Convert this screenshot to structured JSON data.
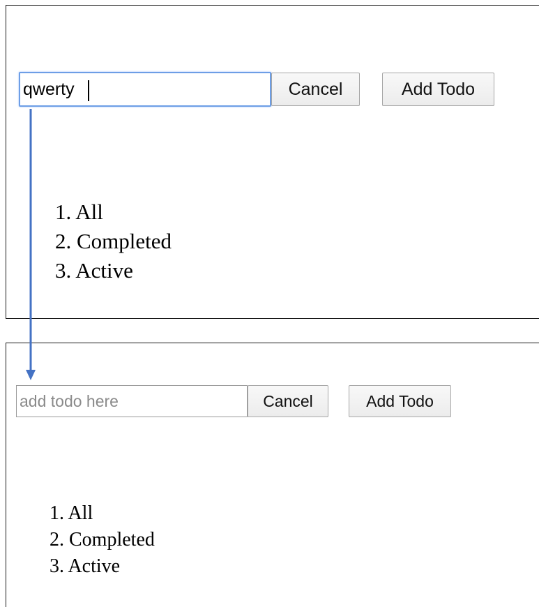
{
  "states": [
    {
      "input_value": "qwerty",
      "input_placeholder": "add todo here",
      "cancel_label": "Cancel",
      "add_label": "Add Todo",
      "filters": [
        "1. All",
        "2. Completed",
        "3. Active"
      ]
    },
    {
      "input_value": "",
      "input_placeholder": "add todo here",
      "cancel_label": "Cancel",
      "add_label": "Add Todo",
      "filters": [
        "1. All",
        "2. Completed",
        "3. Active"
      ]
    }
  ],
  "colors": {
    "arrow": "#4472c4",
    "focus_border": "#6d9ee6",
    "panel_border": "#1a1a1a"
  },
  "icons": {
    "transition": "arrow-down-icon"
  }
}
